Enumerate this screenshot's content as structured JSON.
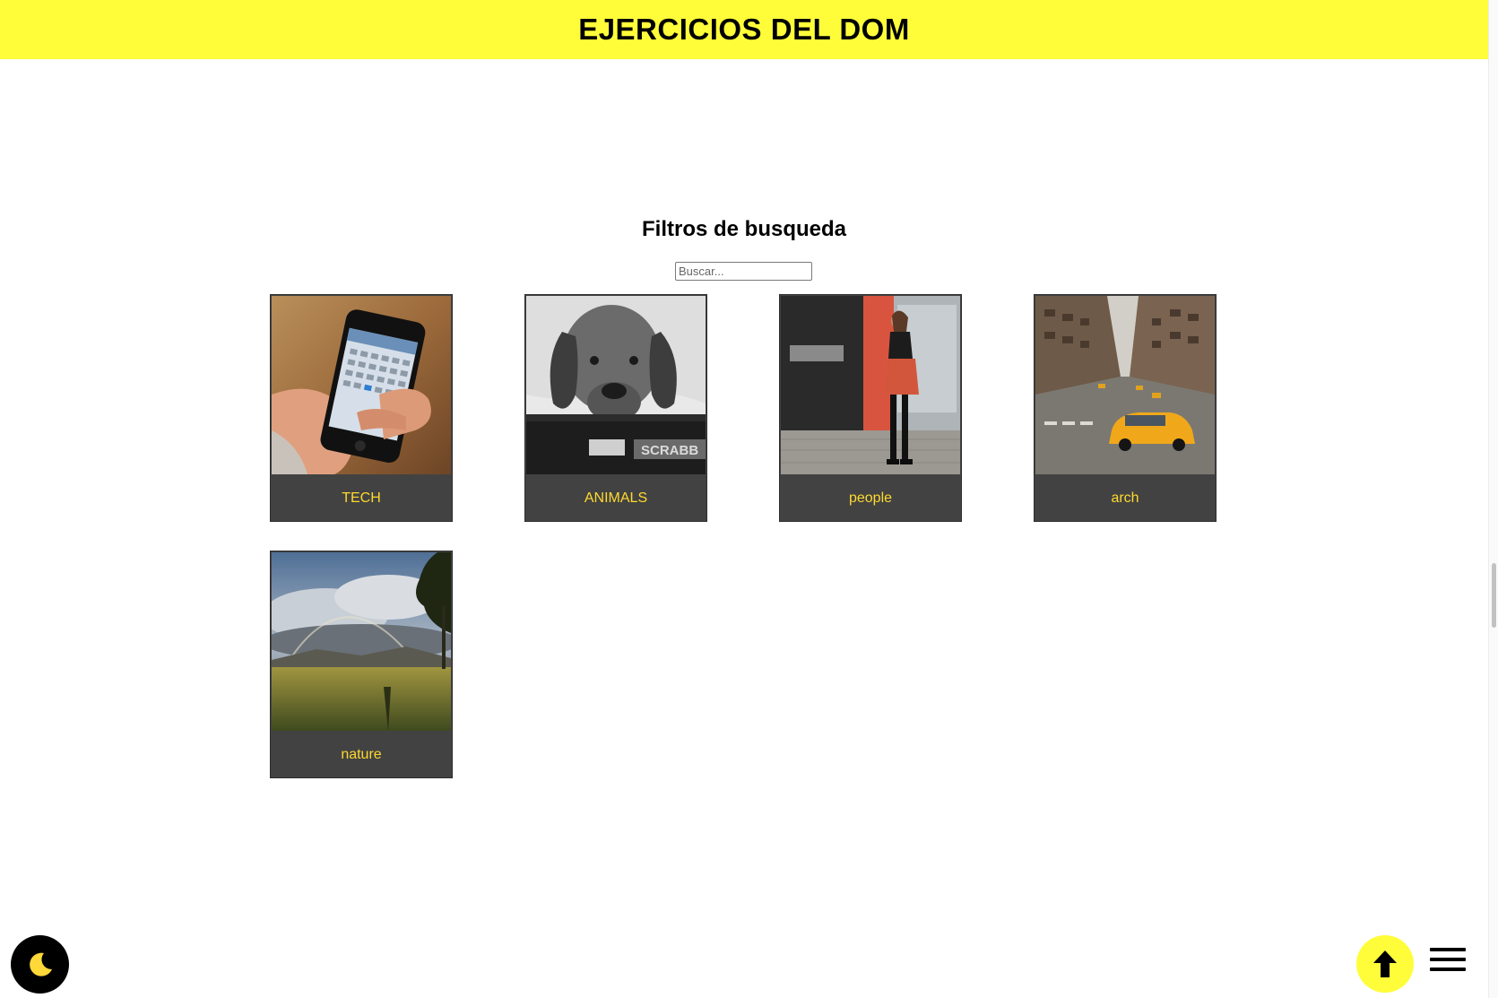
{
  "header": {
    "title": "EJERCICIOS DEL DOM"
  },
  "filters": {
    "title": "Filtros de busqueda",
    "search_placeholder": "Buscar...",
    "search_value": ""
  },
  "cards": [
    {
      "label": "TECH",
      "image": "hand-holding-smartphone-calendar"
    },
    {
      "label": "ANIMALS",
      "image": "dog-resting-on-scrabble-box"
    },
    {
      "label": "people",
      "image": "woman-looking-at-phone-on-street"
    },
    {
      "label": "arch",
      "image": "city-street-with-yellow-taxi"
    },
    {
      "label": "nature",
      "image": "field-under-cloudy-sky-with-rainbow"
    }
  ],
  "controls": {
    "dark_mode_icon": "moon-icon",
    "scroll_top_icon": "arrow-up-icon",
    "menu_icon": "hamburger-icon"
  },
  "colors": {
    "header_bg": "#fffd3a",
    "card_bg": "#424242",
    "card_label": "#ffd92e",
    "dark_button": "#000000",
    "top_button": "#fffd3a"
  }
}
